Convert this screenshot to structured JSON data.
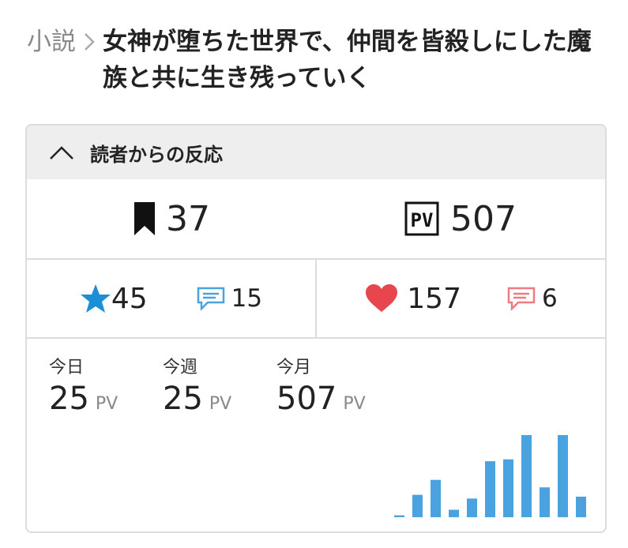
{
  "breadcrumb": {
    "category": "小説",
    "title": "女神が堕ちた世界で、仲間を皆殺しにした魔族と共に生き残っていく"
  },
  "reactions": {
    "header_title": "読者からの反応",
    "bookmarks": "37",
    "pv_total": "507",
    "stars": "45",
    "star_comments": "15",
    "hearts": "157",
    "heart_comments": "6",
    "today": {
      "label": "今日",
      "value": "25",
      "unit": "PV"
    },
    "week": {
      "label": "今週",
      "value": "25",
      "unit": "PV"
    },
    "month": {
      "label": "今月",
      "value": "507",
      "unit": "PV"
    }
  },
  "colors": {
    "accent_blue": "#4aa3df",
    "heart_red": "#e8464e",
    "comment_red": "#ef7a7f",
    "divider": "#dcdcdc"
  },
  "chart_data": {
    "type": "bar",
    "categories": [
      "1",
      "2",
      "3",
      "4",
      "5",
      "6",
      "7",
      "8",
      "9",
      "10"
    ],
    "values": [
      0.5,
      6,
      10,
      2,
      5,
      15,
      15.5,
      22,
      8,
      22,
      5.5
    ],
    "ylim": [
      0,
      22
    ]
  }
}
